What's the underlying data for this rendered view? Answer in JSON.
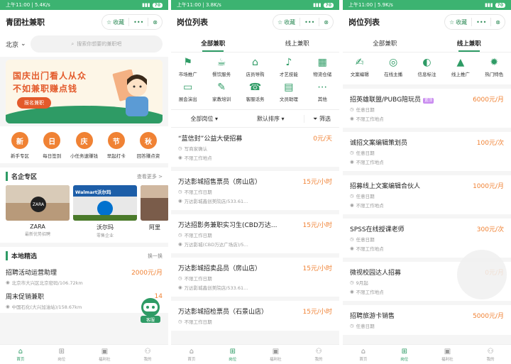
{
  "status": {
    "time": "上午11:00",
    "speed1": "5.4K/s",
    "speed2": "3.8K/s",
    "speed3": "5.9K/s",
    "battery": "70"
  },
  "header": {
    "collect": "收藏",
    "more": "•••"
  },
  "home": {
    "title": "青团社兼职",
    "city": "北京",
    "search_placeholder": "搜索你想要的兼职吧",
    "banner": {
      "line1": "国庆出门看人从众",
      "line2": "不如兼职赚点钱",
      "button": "报名兼职"
    },
    "categories": [
      {
        "char": "新",
        "label": "新手专区"
      },
      {
        "char": "日",
        "label": "每日签到"
      },
      {
        "char": "庆",
        "label": "小任务速赚钱"
      },
      {
        "char": "节",
        "label": "早起打卡"
      },
      {
        "char": "秋",
        "label": "回答赚点资"
      }
    ],
    "brands_title": "名企专区",
    "brands_more": "查看更多 >",
    "brands": [
      {
        "name": "ZARA",
        "sub": "最新优势招聘",
        "logo": "ZARA"
      },
      {
        "name": "沃尔玛",
        "sub": "零售企业",
        "logo": "Walmart沃尔玛"
      },
      {
        "name": "阿里",
        "sub": "",
        "logo": ""
      }
    ],
    "local_title": "本地精选",
    "local_more": "换一换",
    "local_items": [
      {
        "title": "招聘活动运营助理",
        "salary": "2000元/月",
        "place": "北京市大兴区北京密码/106.72km"
      },
      {
        "title": "周末促销兼职",
        "salary": "14",
        "place": "中国石化(大兴加油站)/158.67km"
      }
    ],
    "service_label": "客服"
  },
  "tabs": {
    "home": "首页",
    "jobs": "岗位",
    "welfare": "福利社",
    "mine": "我的"
  },
  "list": {
    "title": "岗位列表",
    "subtab_all": "全部兼职",
    "subtab_online": "线上兼职",
    "icons_all": [
      {
        "icon": "market-icon",
        "label": "市场推广"
      },
      {
        "icon": "food-icon",
        "label": "餐饮服务"
      },
      {
        "icon": "store-icon",
        "label": "店员导购"
      },
      {
        "icon": "talent-icon",
        "label": "才艺技能"
      },
      {
        "icon": "logistics-icon",
        "label": "物流仓储"
      },
      {
        "icon": "show-icon",
        "label": "展会演出"
      },
      {
        "icon": "tutor-icon",
        "label": "家教培训"
      },
      {
        "icon": "service-icon",
        "label": "客服话务"
      },
      {
        "icon": "doc-icon",
        "label": "文员助理"
      },
      {
        "icon": "other-icon",
        "label": "其他"
      }
    ],
    "filter_all": "全部岗位 ▾",
    "filter_sort": "默认排序 ▾",
    "filter_screen": "筛选",
    "jobs_all": [
      {
        "title": "“蓝信封”公益大使招募",
        "salary": "0元/天",
        "l1": "写商家确认",
        "l2": "不限工作地点"
      },
      {
        "title": "万达影城招售票员（房山店）",
        "salary": "15元/小时",
        "l1": "不限工作日期",
        "l2": "万达影城鑫创美院店/533.61..."
      },
      {
        "title": "万达招影务兼职实习生(CBD万达...",
        "salary": "15元/小时",
        "l1": "不限工作日期",
        "l2": "万达影城(CBD万达广场店)/5..."
      },
      {
        "title": "万达影城招卖品员（房山店）",
        "salary": "15元/小时",
        "l1": "不限工作日期",
        "l2": "万达影城鑫创美院店/533.61..."
      },
      {
        "title": "万达影城招检票员（石景山店）",
        "salary": "15元/小时",
        "l1": "不限工作日期",
        "l2": ""
      }
    ],
    "icons_online": [
      {
        "icon": "copywriting-icon",
        "label": "文案编辑"
      },
      {
        "icon": "anchor-icon",
        "label": "在线主播"
      },
      {
        "icon": "label-icon",
        "label": "信息标注"
      },
      {
        "icon": "promo-icon",
        "label": "线上推广"
      },
      {
        "icon": "hot-icon",
        "label": "热门特色"
      }
    ],
    "jobs_online": [
      {
        "title": "招英雄联盟/PUBG陪玩员",
        "tag": "置顶",
        "salary": "6000元/月",
        "l1": "任意日期",
        "l2": "不限工作地点"
      },
      {
        "title": "诚招文案编辑策划员",
        "tag": "",
        "salary": "100元/次",
        "l1": "任意日期",
        "l2": "不限工作地点"
      },
      {
        "title": "招募线上文案编辑合伙人",
        "tag": "",
        "salary": "1000元/月",
        "l1": "任意日期",
        "l2": "不限工作地点"
      },
      {
        "title": "SPSS在线授课老师",
        "tag": "",
        "salary": "300元/次",
        "l1": "任意日期",
        "l2": "不限工作地点"
      },
      {
        "title": "微视校园达人招募",
        "tag": "",
        "salary": "0元/月",
        "l1": "9月起",
        "l2": "不限工作地点"
      },
      {
        "title": "招聘旅游卡销售",
        "tag": "",
        "salary": "5000元/月",
        "l1": "任意日期",
        "l2": ""
      }
    ]
  },
  "colors": {
    "primary": "#2e9b65",
    "accent": "#f08234",
    "status": "#3cb371"
  }
}
